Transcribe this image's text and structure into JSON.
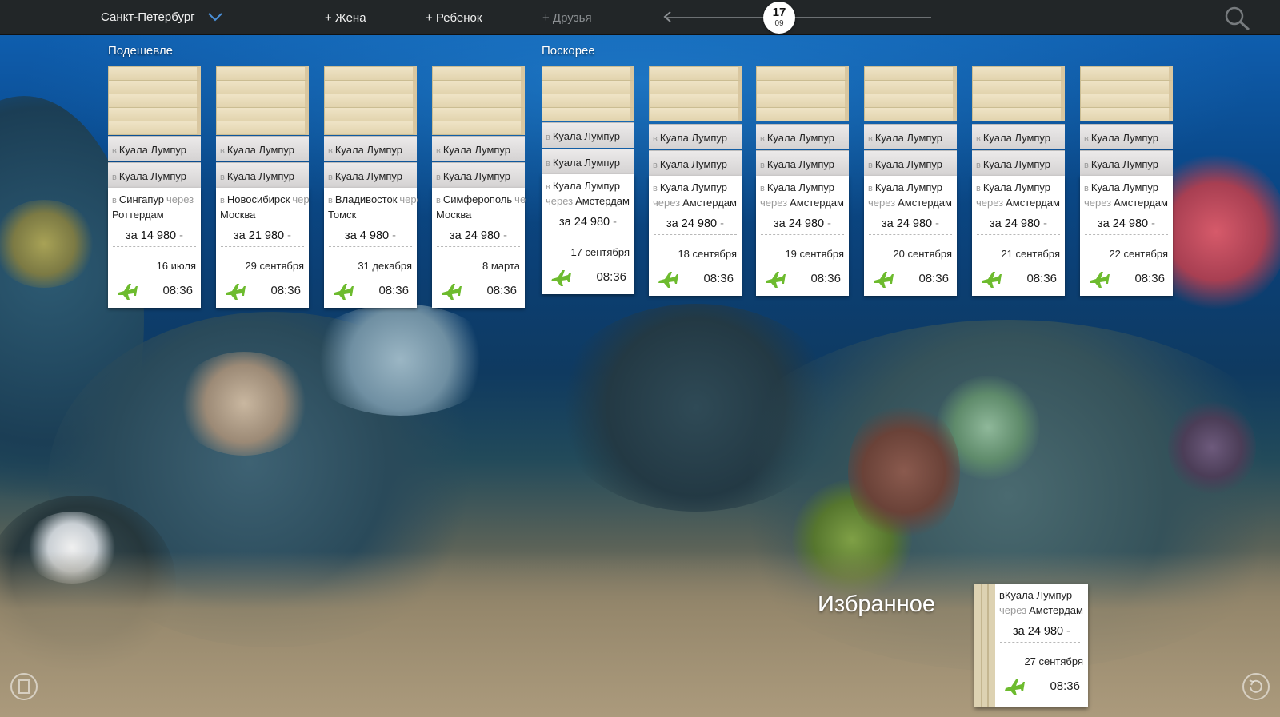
{
  "topbar": {
    "city": "Санкт-Петербург",
    "add_wife": "+ Жена",
    "add_child": "+ Ребенок",
    "add_friends": "+ Друзья",
    "slider_day": "17",
    "slider_month": "09",
    "icons": [
      "chevron-down-icon",
      "arrow-left-icon",
      "search-icon"
    ]
  },
  "sections": {
    "cheaper": "Подешевле",
    "faster": "Поскорее"
  },
  "labels": {
    "prefix_to": "в",
    "via": "через",
    "price_prefix": "за",
    "price_dash": "-",
    "stack_destination": "Куала Лумпур"
  },
  "cards": [
    {
      "dest": "Сингапур",
      "via": "Роттердам",
      "price": "14 980",
      "date": "16 июля",
      "time": "08:36"
    },
    {
      "dest": "Новосибирск",
      "via": "Москва",
      "price": "21 980",
      "date": "29 сентября",
      "time": "08:36"
    },
    {
      "dest": "Владивосток",
      "via": "Томск",
      "price": "4 980",
      "date": "31 декабря",
      "time": "08:36"
    },
    {
      "dest": "Симферополь",
      "via": "Москва",
      "price": "24 980",
      "date": "8 марта",
      "time": "08:36"
    },
    {
      "dest": "Куала Лумпур",
      "via": "Амстердам",
      "price": "24 980",
      "date": "17 сентября",
      "time": "08:36"
    },
    {
      "dest": "Куала Лумпур",
      "via": "Амстердам",
      "price": "24 980",
      "date": "18 сентября",
      "time": "08:36"
    },
    {
      "dest": "Куала Лумпур",
      "via": "Амстердам",
      "price": "24 980",
      "date": "19 сентября",
      "time": "08:36"
    },
    {
      "dest": "Куала Лумпур",
      "via": "Амстердам",
      "price": "24 980",
      "date": "20 сентября",
      "time": "08:36"
    },
    {
      "dest": "Куала Лумпур",
      "via": "Амстердам",
      "price": "24 980",
      "date": "21 сентября",
      "time": "08:36"
    },
    {
      "dest": "Куала Лумпур",
      "via": "Амстердам",
      "price": "24 980",
      "date": "22 сентября",
      "time": "08:36"
    }
  ],
  "favorites": {
    "title": "Избранное",
    "card": {
      "dest": "Куала Лумпур",
      "via": "Амстердам",
      "price": "24 980",
      "date": "27 сентября",
      "time": "08:36"
    }
  },
  "colors": {
    "topbar": "#222628",
    "plane": "#6dbb2e",
    "paper": "#e9dcb9",
    "card": "#ffffff"
  }
}
